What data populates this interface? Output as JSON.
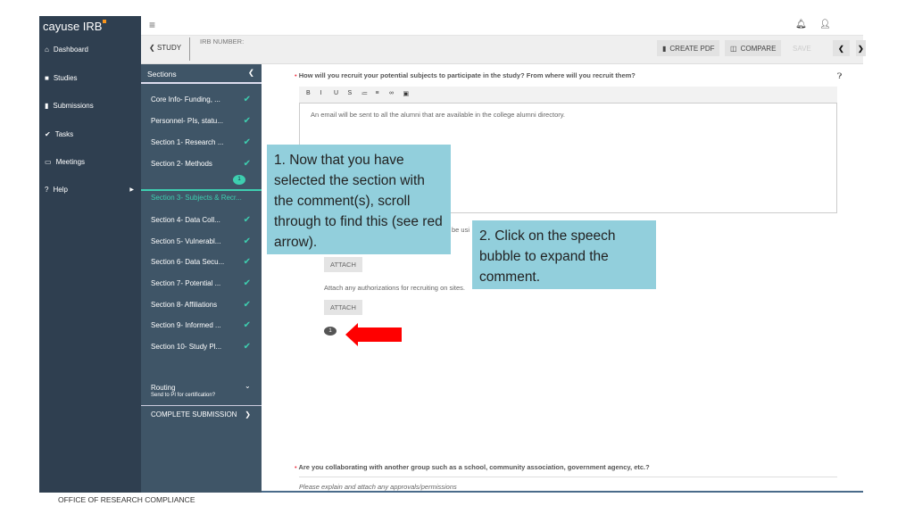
{
  "app": {
    "logo": "cayuse IRB",
    "accent": "#f7941d"
  },
  "nav": [
    {
      "icon": "home-icon",
      "label": "Dashboard"
    },
    {
      "icon": "folder-icon",
      "label": "Studies"
    },
    {
      "icon": "file-icon",
      "label": "Submissions"
    },
    {
      "icon": "check-icon",
      "label": "Tasks"
    },
    {
      "icon": "calendar-icon",
      "label": "Meetings"
    },
    {
      "icon": "question-icon",
      "label": "Help"
    }
  ],
  "header": {
    "back_label": "STUDY",
    "irb_label": "IRB NUMBER:",
    "create_pdf": "CREATE PDF",
    "compare": "COMPARE",
    "save": "SAVE"
  },
  "sections": {
    "title": "Sections",
    "items": [
      "Core Info- Funding, ...",
      "Personnel- PIs, statu...",
      "Section 1- Research ...",
      "Section 2- Methods",
      "Section 3- Subjects & Recr...",
      "Section 4- Data Coll...",
      "Section 5- Vulnerabl...",
      "Section 6- Data Secu...",
      "Section 7- Potential ...",
      "Section 8- Affiliations",
      "Section 9- Informed ...",
      "Section 10- Study Pl..."
    ],
    "comment_count": "1",
    "routing": "Routing",
    "routing_sub": "Send to PI for certification?",
    "complete": "COMPLETE SUBMISSION"
  },
  "main": {
    "q1": "How will you recruit your potential subjects to participate in the study? From where will you recruit them?",
    "toolbar": [
      "B",
      "I",
      "U",
      "S",
      "≔",
      "≡",
      "∞",
      "▣"
    ],
    "answer": "An email will be sent to all the alumni that are available in the college alumni directory.",
    "partial": "be usi",
    "attach1": "ATTACH",
    "auth_text": "Attach any authorizations for recruiting on sites.",
    "attach2": "ATTACH",
    "comment_count": "1",
    "q2": "Are you collaborating with another group such as a school, community association, government agency, etc.?",
    "q2_hint": "Please explain and attach any approvals/permissions"
  },
  "callouts": {
    "one": "1. Now that you have selected the section with the comment(s), scroll through to find this (see red arrow).",
    "two": "2. Click on the speech bubble to expand the comment."
  },
  "footer": "OFFICE OF RESEARCH COMPLIANCE"
}
